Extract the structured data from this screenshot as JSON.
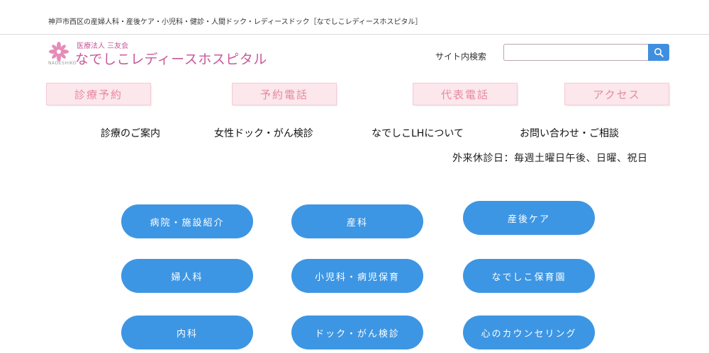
{
  "header": {
    "tagline": "神戸市西区の産婦人科・産後ケア・小児科・健診・人間ドック・レディースドック［なでしこレディースホスピタル］"
  },
  "logo": {
    "org": "医療法人 三友会",
    "name": "なでしこレディースホスピタル",
    "sub": "NADESHIKO"
  },
  "search": {
    "label": "サイト内検索",
    "placeholder": "",
    "button_icon": "search-icon"
  },
  "quick_links": [
    {
      "label": "診療予約"
    },
    {
      "label": "予約電話"
    },
    {
      "label": "代表電話"
    },
    {
      "label": "アクセス"
    }
  ],
  "nav": [
    {
      "label": "診療のご案内"
    },
    {
      "label": "女性ドック・がん検診"
    },
    {
      "label": "なでしこLHについて"
    },
    {
      "label": "お問い合わせ・ご相談"
    }
  ],
  "notice": "外来休診日：毎週土曜日午後、日曜、祝日",
  "menu_buttons": [
    {
      "label": "病院・施設紹介"
    },
    {
      "label": "産科"
    },
    {
      "label": "産後ケア"
    },
    {
      "label": "婦人科"
    },
    {
      "label": "小児科・病児保育"
    },
    {
      "label": "なでしこ保育園"
    },
    {
      "label": "内科"
    },
    {
      "label": "ドック・がん検診"
    },
    {
      "label": "心のカウンセリング"
    }
  ],
  "colors": {
    "brand_pink": "#c8589a",
    "quick_bg": "#fbe7ec",
    "quick_text": "#e8899f",
    "button_blue": "#3d96e3",
    "search_blue": "#3f8fe0"
  }
}
